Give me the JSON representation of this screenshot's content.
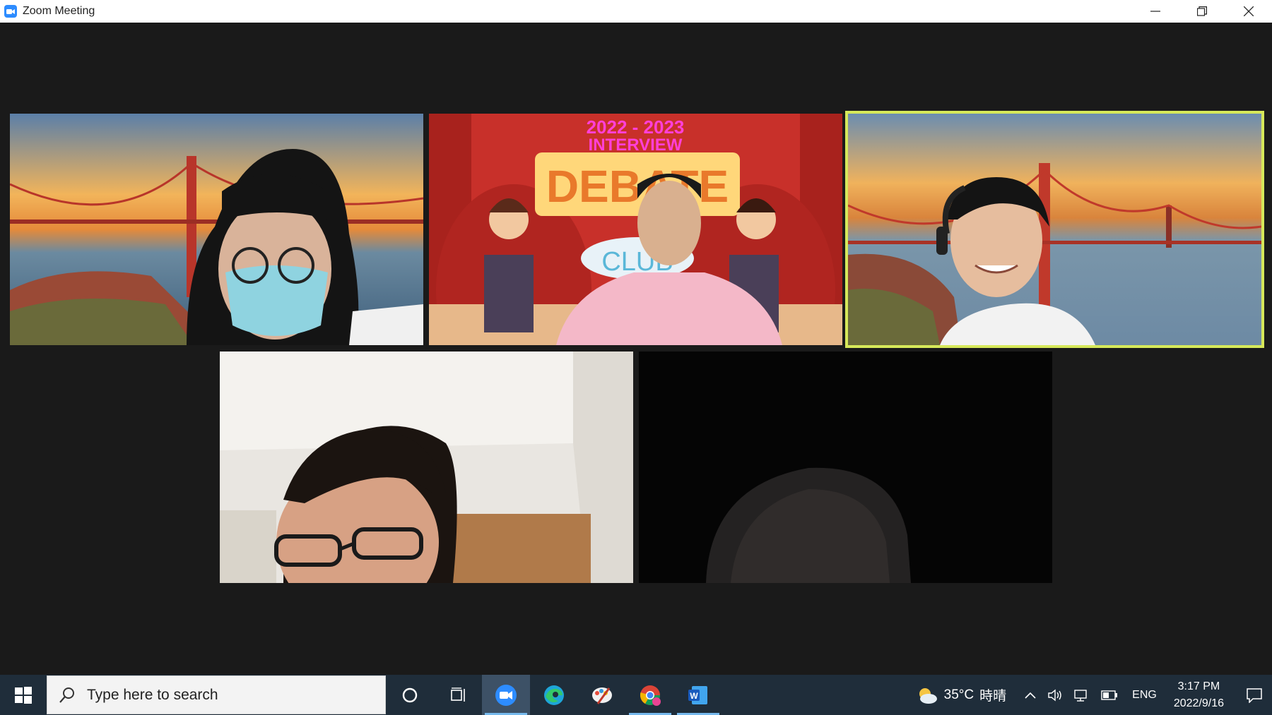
{
  "window": {
    "title": "Zoom Meeting",
    "app_icon": "zoom-icon",
    "controls": [
      "minimize-icon",
      "restore-icon",
      "close-icon"
    ]
  },
  "meeting": {
    "active_speaker_color": "#d6e85a",
    "background_color": "#1a1a1a",
    "tiles": [
      {
        "name": "participant-1",
        "background": "golden-gate-bridge"
      },
      {
        "name": "participant-2",
        "background": "debate-banner",
        "banner": {
          "year_text": "2022 - 2023",
          "subtitle": "INTERVIEW",
          "board_text": "DEBATE",
          "bubble_text": "CLUB"
        }
      },
      {
        "name": "participant-3",
        "background": "golden-gate-bridge",
        "active_speaker": true
      },
      {
        "name": "participant-4",
        "background": "room"
      },
      {
        "name": "participant-5",
        "background": "dark"
      }
    ]
  },
  "taskbar": {
    "search_placeholder": "Type here to search",
    "pinned": [
      "cortana-icon",
      "task-view-icon",
      "zoom-icon",
      "edge-icon",
      "paint-icon",
      "chrome-icon",
      "word-icon"
    ],
    "weather": {
      "temp": "35°C",
      "condition": "時晴"
    },
    "language": "ENG",
    "time": "3:17 PM",
    "date": "2022/9/16",
    "color": "#1f2d3a"
  }
}
